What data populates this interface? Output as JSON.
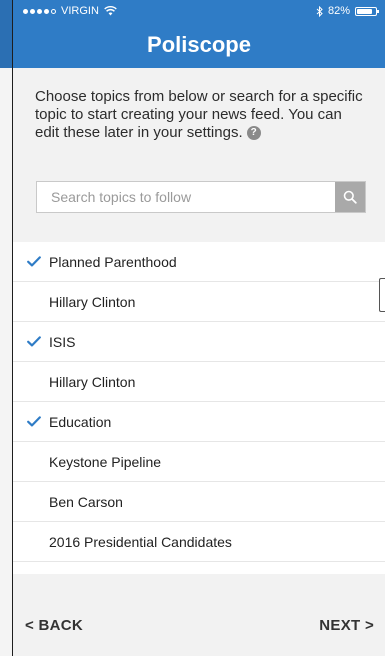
{
  "status_bar": {
    "carrier": "VIRGIN",
    "battery": "82%",
    "battery_level": 0.82
  },
  "header": {
    "title": "Poliscope"
  },
  "intro": {
    "text": "Choose topics from below or search for a specific topic to start creating your news feed. You can edit these later in your settings."
  },
  "search": {
    "placeholder": "Search topics to follow",
    "icon": "search-icon"
  },
  "topics": [
    {
      "label": "Planned Parenthood",
      "checked": true
    },
    {
      "label": "Hillary Clinton",
      "checked": false
    },
    {
      "label": "ISIS",
      "checked": true
    },
    {
      "label": "Hillary Clinton",
      "checked": false
    },
    {
      "label": "Education",
      "checked": true
    },
    {
      "label": "Keystone Pipeline",
      "checked": false
    },
    {
      "label": "Ben Carson",
      "checked": false
    },
    {
      "label": "2016 Presidential Candidates",
      "checked": false
    }
  ],
  "footer": {
    "back_label": "< BACK",
    "next_label": "NEXT >"
  },
  "colors": {
    "brand": "#2f7cc6",
    "check": "#2f7cc6"
  }
}
